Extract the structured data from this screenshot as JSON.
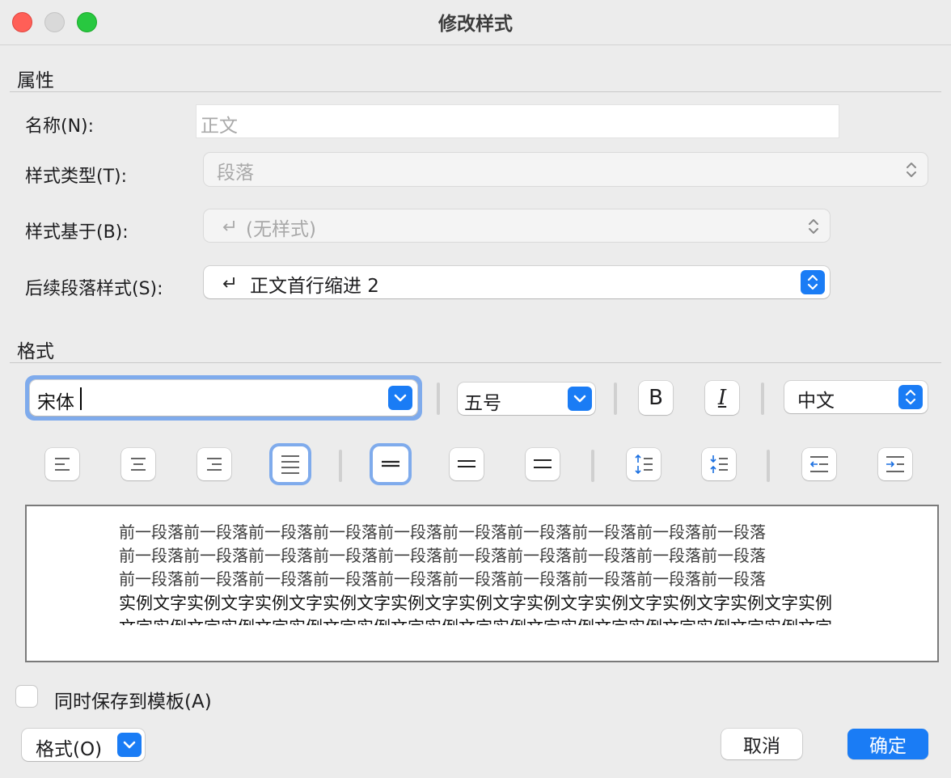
{
  "window": {
    "title": "修改样式",
    "buttons": [
      "close",
      "minimize",
      "zoom"
    ]
  },
  "properties": {
    "section_title": "属性",
    "name": {
      "label": "名称(N):",
      "placeholder": "正文",
      "value": ""
    },
    "style_type": {
      "label": "样式类型(T):",
      "value": "段落",
      "enabled": false
    },
    "based_on": {
      "label": "样式基于(B):",
      "value": "(无样式)",
      "icon": "return-arrow-icon",
      "enabled": false
    },
    "following": {
      "label": "后续段落样式(S):",
      "value": "正文首行缩进 2",
      "icon": "return-arrow-icon",
      "enabled": true
    }
  },
  "format": {
    "section_title": "格式",
    "font_name": "宋体",
    "font_size": "五号",
    "bold_label": "B",
    "italic_label": "I",
    "script": "中文",
    "alignment_buttons": [
      "align-left",
      "align-center",
      "align-right",
      "align-justify"
    ],
    "selected_alignment": "align-justify",
    "line_spacing_buttons": [
      "single-spacing",
      "one-half-spacing",
      "double-spacing"
    ],
    "selected_line_spacing": "single-spacing",
    "paragraph_spacing_buttons": [
      "increase-paragraph-spacing",
      "decrease-paragraph-spacing"
    ],
    "indent_buttons": [
      "decrease-indent",
      "increase-indent"
    ]
  },
  "preview": {
    "previous_lines": [
      "前一段落前一段落前一段落前一段落前一段落前一段落前一段落前一段落前一段落前一段落",
      "前一段落前一段落前一段落前一段落前一段落前一段落前一段落前一段落前一段落前一段落",
      "前一段落前一段落前一段落前一段落前一段落前一段落前一段落前一段落前一段落前一段落"
    ],
    "sample_lines": [
      "实例文字实例文字实例文字实例文字实例文字实例文字实例文字实例文字实例文字实例文字实例",
      "文字实例文字实例文字实例文字实例文字实例文字实例文字实例文字实例文字实例文字实例文字"
    ]
  },
  "save_to_template": {
    "label": "同时保存到模板(A)",
    "checked": false
  },
  "footer": {
    "format_menu_label": "格式(O)",
    "cancel_label": "取消",
    "ok_label": "确定"
  },
  "colors": {
    "accent": "#1a7cf5",
    "focus_ring": "#7fabec",
    "window_bg": "#ececec"
  }
}
